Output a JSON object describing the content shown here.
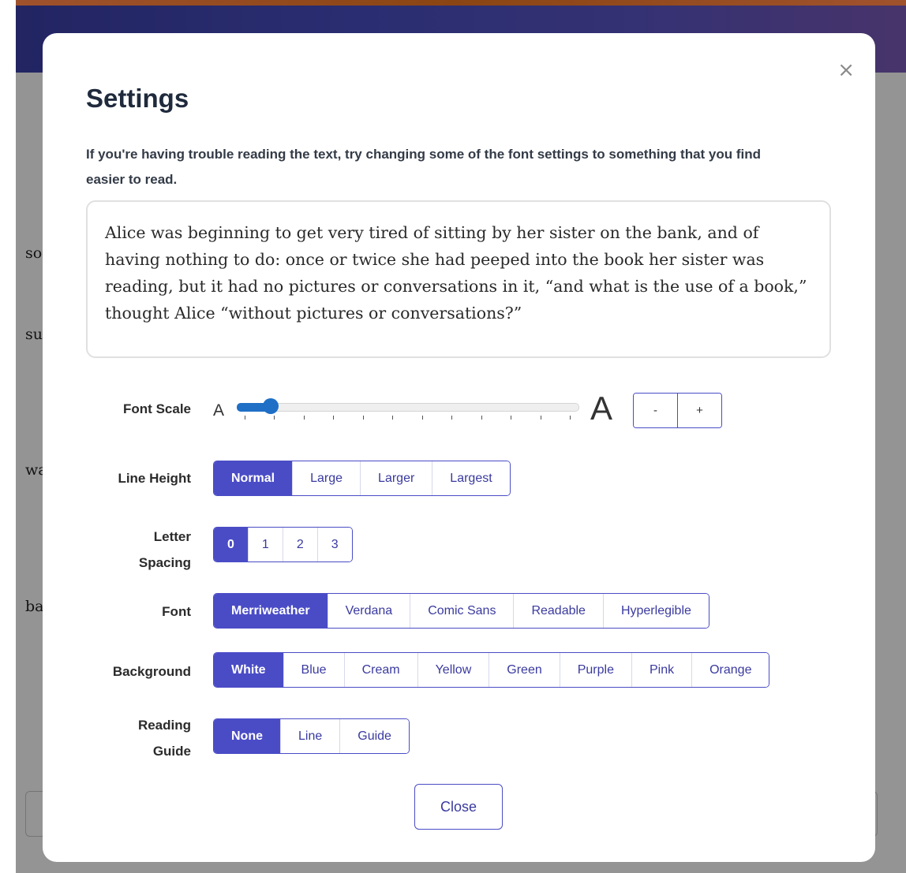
{
  "background_page": {
    "fragments": [
      "so",
      "su",
      "wa",
      "ba"
    ]
  },
  "modal": {
    "close_icon": "×",
    "title": "Settings",
    "description": "If you're having trouble reading the text, try changing some of the font settings to something that you find easier to read.",
    "preview_text": "Alice was beginning to get very tired of sitting by her sister on the bank, and of having nothing to do: once or twice she had peeped into the book her sister was reading, but it had no pictures or conversations in it, “and what is the use of a book,” thought Alice “without pictures or conversations?”",
    "font_scale": {
      "label": "Font Scale",
      "small_a": "A",
      "large_a": "A",
      "value_fraction": 0.1,
      "ticks": 12,
      "decrement": "-",
      "increment": "+"
    },
    "line_height": {
      "label": "Line Height",
      "options": [
        "Normal",
        "Large",
        "Larger",
        "Largest"
      ],
      "selected": "Normal"
    },
    "letter_spacing": {
      "label_line1": "Letter",
      "label_line2": "Spacing",
      "options": [
        "0",
        "1",
        "2",
        "3"
      ],
      "selected": "0"
    },
    "font": {
      "label": "Font",
      "options": [
        "Merriweather",
        "Verdana",
        "Comic Sans",
        "Readable",
        "Hyperlegible"
      ],
      "selected": "Merriweather"
    },
    "background": {
      "label": "Background",
      "options": [
        "White",
        "Blue",
        "Cream",
        "Yellow",
        "Green",
        "Purple",
        "Pink",
        "Orange"
      ],
      "selected": "White"
    },
    "reading_guide": {
      "label_line1": "Reading",
      "label_line2": "Guide",
      "options": [
        "None",
        "Line",
        "Guide"
      ],
      "selected": "None"
    },
    "close_button": "Close"
  },
  "colors": {
    "accent": "#4a4cc6",
    "slider": "#1f6fc6"
  }
}
